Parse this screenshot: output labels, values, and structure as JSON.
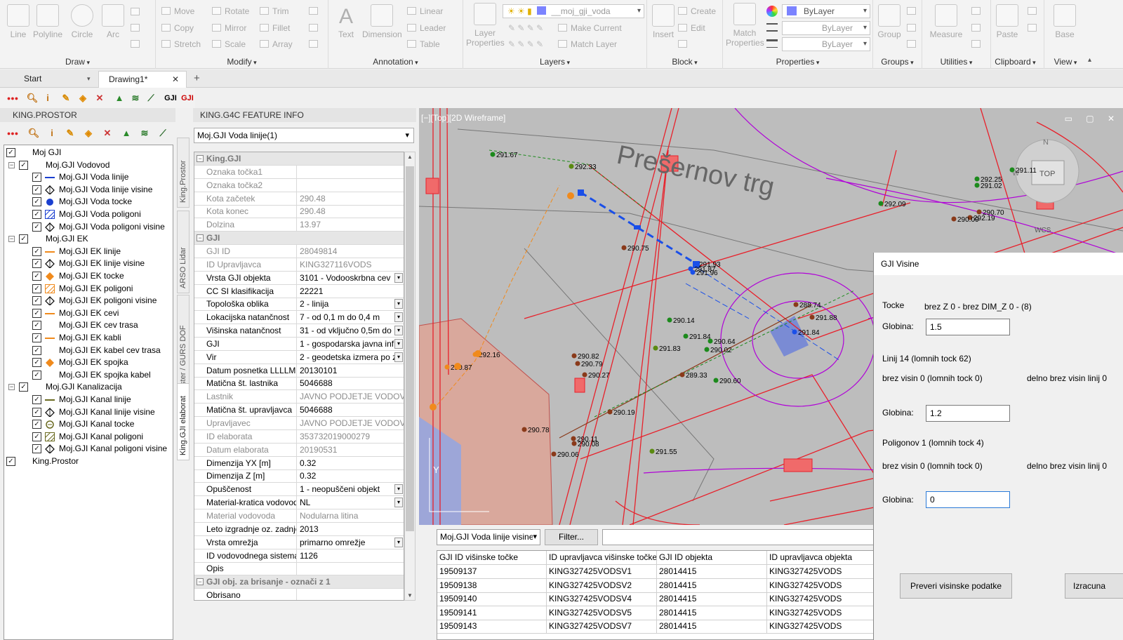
{
  "ribbon": {
    "draw": {
      "label": "Draw",
      "line": "Line",
      "polyline": "Polyline",
      "circle": "Circle",
      "arc": "Arc"
    },
    "modify": {
      "label": "Modify",
      "move": "Move",
      "rotate": "Rotate",
      "trim": "Trim",
      "copy": "Copy",
      "mirror": "Mirror",
      "fillet": "Fillet",
      "stretch": "Stretch",
      "scale": "Scale",
      "array": "Array"
    },
    "annotation": {
      "label": "Annotation",
      "text": "Text",
      "dimension": "Dimension",
      "linear": "Linear",
      "leader": "Leader",
      "table": "Table"
    },
    "layers": {
      "label": "Layers",
      "layer_properties": "Layer Properties",
      "current_layer": "__moj_gji_voda",
      "make_current": "Make Current",
      "match_layer": "Match Layer"
    },
    "block": {
      "label": "Block",
      "insert": "Insert",
      "create": "Create",
      "edit": "Edit"
    },
    "properties": {
      "label": "Properties",
      "match_properties": "Match Properties",
      "color": "ByLayer",
      "linetype": "ByLayer",
      "lineweight": "ByLayer"
    },
    "groups": {
      "label": "Groups",
      "group": "Group"
    },
    "utilities": {
      "label": "Utilities",
      "measure": "Measure"
    },
    "clipboard": {
      "label": "Clipboard",
      "paste": "Paste"
    },
    "view": {
      "label": "View",
      "base": "Base"
    }
  },
  "tabs": {
    "start": "Start",
    "drawing": "Drawing1*"
  },
  "toolbar2": {
    "gji1": "GJI",
    "gji2": "GJI"
  },
  "left_panel": {
    "title": "KING.PROSTOR",
    "tree": [
      {
        "label": "Moj GJI",
        "level": 0,
        "expander": "",
        "checked": true
      },
      {
        "label": "Moj.GJI Vodovod",
        "level": 1,
        "expander": "−",
        "checked": true
      },
      {
        "label": "Moj.GJI Voda linije",
        "level": 2,
        "legend": "line-blue",
        "checked": true
      },
      {
        "label": "Moj.GJI Voda linije visine",
        "level": 2,
        "legend": "diamond",
        "checked": true
      },
      {
        "label": "Moj.GJI Voda tocke",
        "level": 2,
        "legend": "dot-blue",
        "checked": true
      },
      {
        "label": "Moj.GJI Voda poligoni",
        "level": 2,
        "legend": "hatch-blue",
        "checked": true
      },
      {
        "label": "Moj.GJI Voda poligoni visine",
        "level": 2,
        "legend": "diamond",
        "checked": true
      },
      {
        "label": "Moj.GJI EK",
        "level": 1,
        "expander": "−",
        "checked": true
      },
      {
        "label": "Moj.GJI EK linije",
        "level": 2,
        "legend": "line-orange",
        "checked": true
      },
      {
        "label": "Moj.GJI EK linije visine",
        "level": 2,
        "legend": "diamond",
        "checked": true
      },
      {
        "label": "Moj.GJI EK tocke",
        "level": 2,
        "legend": "dot-orange",
        "checked": true
      },
      {
        "label": "Moj.GJI EK poligoni",
        "level": 2,
        "legend": "hatch-orange",
        "checked": true
      },
      {
        "label": "Moj.GJI EK poligoni visine",
        "level": 2,
        "legend": "diamond",
        "checked": true
      },
      {
        "label": "Moj.GJI EK cevi",
        "level": 2,
        "legend": "line-orange",
        "checked": true
      },
      {
        "label": "Moj.GJI EK cev trasa",
        "level": 2,
        "legend": "none",
        "checked": true
      },
      {
        "label": "Moj.GJI EK kabli",
        "level": 2,
        "legend": "line-orange",
        "checked": true
      },
      {
        "label": "Moj.GJI EK kabel cev trasa",
        "level": 2,
        "legend": "none",
        "checked": true
      },
      {
        "label": "Moj.GJI EK spojka",
        "level": 2,
        "legend": "dot-orange",
        "checked": true
      },
      {
        "label": "Moj.GJI EK spojka kabel",
        "level": 2,
        "legend": "none",
        "checked": true
      },
      {
        "label": "Moj.GJI Kanalizacija",
        "level": 1,
        "expander": "−",
        "checked": true
      },
      {
        "label": "Moj.GJI Kanal linije",
        "level": 2,
        "legend": "line-olive",
        "checked": true
      },
      {
        "label": "Moj.GJI Kanal linije visine",
        "level": 2,
        "legend": "diamond",
        "checked": true
      },
      {
        "label": "Moj.GJI Kanal tocke",
        "level": 2,
        "legend": "dot-olive",
        "checked": true
      },
      {
        "label": "Moj.GJI Kanal poligoni",
        "level": 2,
        "legend": "hatch-olive",
        "checked": true
      },
      {
        "label": "Moj.GJI Kanal poligoni visine",
        "level": 2,
        "legend": "diamond",
        "checked": true
      },
      {
        "label": "King.Prostor",
        "level": 0,
        "expander": "",
        "checked": true
      }
    ],
    "side_tabs": [
      "King.Prostor",
      "ARSO Lidar",
      "Raster / GURS DOF",
      "King.GJI elaborat"
    ]
  },
  "feature_info": {
    "title": "KING.G4C FEATURE INFO",
    "selected": "Moj.GJI Voda linije(1)",
    "rows": [
      {
        "type": "cat",
        "k": "King.GJI"
      },
      {
        "k": "Oznaka točka1",
        "v": "",
        "ro": true
      },
      {
        "k": "Oznaka točka2",
        "v": "",
        "ro": true
      },
      {
        "k": "Kota začetek",
        "v": "290.48",
        "ro": true
      },
      {
        "k": "Kota konec",
        "v": "290.48",
        "ro": true
      },
      {
        "k": "Dolzina",
        "v": "13.97",
        "ro": true
      },
      {
        "type": "cat",
        "k": "GJI"
      },
      {
        "k": "GJI ID",
        "v": "28049814",
        "ro": true
      },
      {
        "k": "ID Upravljavca",
        "v": "KING327116VODS",
        "ro": true
      },
      {
        "k": "Vrsta GJI objekta",
        "v": "3101 - Vodooskrbna cev",
        "dd": true
      },
      {
        "k": "CC SI klasifikacija",
        "v": "22221"
      },
      {
        "k": "Topološka oblika",
        "v": "2 - linija",
        "dd": true
      },
      {
        "k": "Lokacijska natančnost",
        "v": "7 - od 0,1 m do 0,4 m",
        "dd": true
      },
      {
        "k": "Višinska natančnost",
        "v": "31 - od vključno 0,5m do",
        "dd": true
      },
      {
        "k": "GJI",
        "v": "1 - gospodarska javna inf",
        "dd": true
      },
      {
        "k": "Vir",
        "v": "2 - geodetska izmera po z",
        "dd": true
      },
      {
        "k": "Datum posnetka LLLLMMDD",
        "v": "20130101"
      },
      {
        "k": "Matična št. lastnika",
        "v": "5046688"
      },
      {
        "k": "Lastnik",
        "v": "JAVNO PODJETJE VODOVOD-",
        "ro": true
      },
      {
        "k": "Matična št. upravljavca",
        "v": "5046688"
      },
      {
        "k": "Upravljavec",
        "v": "JAVNO PODJETJE VODOVOD-",
        "ro": true
      },
      {
        "k": "ID elaborata",
        "v": "353732019000279",
        "ro": true
      },
      {
        "k": "Datum elaborata",
        "v": "20190531",
        "ro": true
      },
      {
        "k": "Dimenzija YX [m]",
        "v": "0.32"
      },
      {
        "k": "Dimenzija Z [m]",
        "v": "0.32"
      },
      {
        "k": "Opuščenost",
        "v": "1 - neopuščeni objekt",
        "dd": true
      },
      {
        "k": "Material-kratica vodovoda",
        "v": "NL",
        "dd": true
      },
      {
        "k": "Material vodovoda",
        "v": "Nodularna litina",
        "ro": true
      },
      {
        "k": "Leto izgradnje oz. zadnje",
        "v": "2013"
      },
      {
        "k": "Vrsta omrežja",
        "v": "primarno omrežje",
        "dd": true
      },
      {
        "k": "ID vodovodnega sistema",
        "v": "1126"
      },
      {
        "k": "Opis",
        "v": ""
      },
      {
        "type": "cat",
        "k": "GJI obj. za brisanje - označi z 1"
      },
      {
        "k": "Obrisano",
        "v": ""
      }
    ]
  },
  "drawing": {
    "viewport_label": "[−][Top][2D Wireframe]",
    "street": "Prešernov trg",
    "nav_top": "TOP",
    "nav_n": "N",
    "nav_w": "W",
    "nav_wcs": "WCS",
    "elevations": [
      "291.67",
      "292.33",
      "290.75",
      "291.93",
      "291.87",
      "291.96",
      "288.74",
      "291.88",
      "291.84",
      "290.14",
      "291.84",
      "290.64",
      "291.83",
      "290.82",
      "290.79",
      "290.27",
      "292.16",
      "290.87",
      "290.19",
      "290.60",
      "289.33",
      "290.78",
      "290.11",
      "290.08",
      "290.06",
      "291.55",
      "292.25",
      "291.02",
      "292.09",
      "290.70",
      "292.19",
      "290.09",
      "291.11",
      "290.02"
    ],
    "colors": {
      "background": "#bdbdbd",
      "red": "#e8202a",
      "magenta": "#b000d8",
      "blue": "#1a4fe8",
      "orange": "#f08a1c",
      "green": "#1c8a1c",
      "brown": "#8a3a1a"
    }
  },
  "bottom": {
    "layer_select": "Moj.GJI Voda linije visine",
    "filter_button": "Filter...",
    "filter_value": "",
    "columns": [
      "GJI ID višinske točke",
      "ID upravljavca višinske točke",
      "GJI ID objekta",
      "ID upravljavca objekta"
    ],
    "rows": [
      [
        "19509137",
        "KING327425VODSV1",
        "28014415",
        "KING327425VODS"
      ],
      [
        "19509138",
        "KING327425VODSV2",
        "28014415",
        "KING327425VODS"
      ],
      [
        "19509140",
        "KING327425VODSV4",
        "28014415",
        "KING327425VODS"
      ],
      [
        "19509141",
        "KING327425VODSV5",
        "28014415",
        "KING327425VODS"
      ],
      [
        "19509143",
        "KING327425VODSV7",
        "28014415",
        "KING327425VODS"
      ]
    ]
  },
  "dialog": {
    "title": "GJI Visine",
    "tocke_label": "Tocke",
    "tocke_info": "brez Z 0 - brez DIM_Z 0 - (8)",
    "globina_label": "Globina:",
    "globina_tocke": "1.5",
    "linij_info": "Linij 14 (lomnih tock 62)",
    "linij_brez": "brez visin 0 (lomnih tock 0)",
    "linij_delno": "delno brez visin linij 0",
    "globina_linij": "1.2",
    "poligonov_info": "Poligonov 1 (lomnih tock 4)",
    "poligonov_brez": "brez visin 0 (lomnih tock 0)",
    "poligonov_delno": "delno brez visin linij 0",
    "globina_poligonov": "0",
    "check_button": "Preveri visinske podatke",
    "calc_button": "Izracuna"
  }
}
